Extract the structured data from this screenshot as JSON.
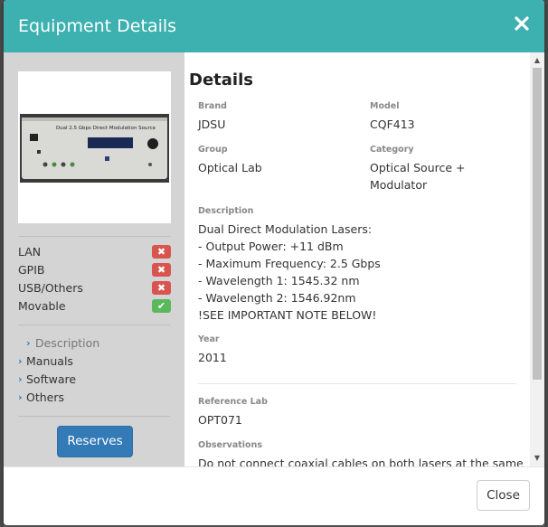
{
  "modal": {
    "title": "Equipment Details",
    "close_icon": "close-icon"
  },
  "sidebar": {
    "features": [
      {
        "label": "LAN",
        "status": "no",
        "symbol": "✖"
      },
      {
        "label": "GPIB",
        "status": "no",
        "symbol": "✖"
      },
      {
        "label": "USB/Others",
        "status": "no",
        "symbol": "✖"
      },
      {
        "label": "Movable",
        "status": "yes",
        "symbol": "✔"
      }
    ],
    "nav": [
      {
        "label": "Description",
        "active": true,
        "chevron": "›"
      },
      {
        "label": "Manuals",
        "active": false,
        "chevron": "›"
      },
      {
        "label": "Software",
        "active": false,
        "chevron": "›"
      },
      {
        "label": "Others",
        "active": false,
        "chevron": "›"
      }
    ],
    "reserves_label": "Reserves",
    "photo_text": "Dual 2.5 Gbps Direct Modulation Source"
  },
  "details": {
    "heading": "Details",
    "brand_label": "Brand",
    "brand": "JDSU",
    "model_label": "Model",
    "model": "CQF413",
    "group_label": "Group",
    "group": "Optical Lab",
    "category_label": "Category",
    "category_line1": "Optical Source +",
    "category_line2": "Modulator",
    "description_label": "Description",
    "description_lines": [
      "Dual Direct Modulation Lasers:",
      "- Output Power: +11 dBm",
      "- Maximum Frequency: 2.5 Gbps",
      "- Wavelength 1: 1545.32 nm",
      "- Wavelength 2: 1546.92nm",
      "!SEE IMPORTANT NOTE BELOW!"
    ],
    "year_label": "Year",
    "year": "2011",
    "reference_lab_label": "Reference Lab",
    "reference_lab": "OPT071",
    "observations_label": "Observations",
    "observations": "Do not connect coaxial cables on both lasers at the same"
  },
  "footer": {
    "close_label": "Close"
  },
  "colors": {
    "header": "#3db0b0",
    "primary_button": "#337ab7",
    "danger": "#d9534f",
    "success": "#5cb85c",
    "sidebar_bg": "#d4d4d4"
  }
}
